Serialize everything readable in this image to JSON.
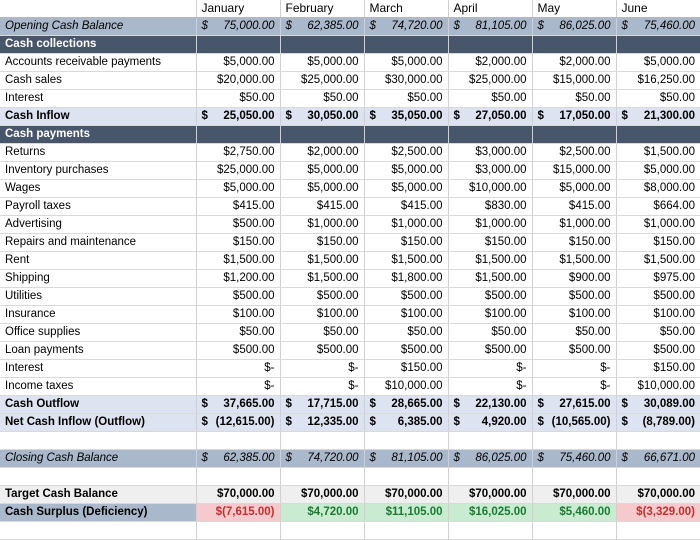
{
  "table": {
    "corner_label": "",
    "columns": [
      "January",
      "February",
      "March",
      "April",
      "May",
      "June"
    ],
    "rows": [
      {
        "kind": "balance",
        "label": "Opening Cash Balance",
        "values": [
          "$  75,000.00",
          "$ 62,385.00",
          "$ 74,720.00",
          "$ 81,105.00",
          "$ 86,025.00",
          "$ 75,460.00"
        ],
        "accounting": [
          "75,000.00",
          "62,385.00",
          "74,720.00",
          "81,105.00",
          "86,025.00",
          "75,460.00"
        ]
      },
      {
        "kind": "section",
        "label": "Cash collections",
        "values": [
          "",
          "",
          "",
          "",
          "",
          ""
        ]
      },
      {
        "kind": "data",
        "label": "Accounts receivable payments",
        "values": [
          "$5,000.00",
          "$5,000.00",
          "$5,000.00",
          "$2,000.00",
          "$2,000.00",
          "$5,000.00"
        ]
      },
      {
        "kind": "data",
        "label": "Cash sales",
        "values": [
          "$20,000.00",
          "$25,000.00",
          "$30,000.00",
          "$25,000.00",
          "$15,000.00",
          "$16,250.00"
        ]
      },
      {
        "kind": "data",
        "label": "Interest",
        "values": [
          "$50.00",
          "$50.00",
          "$50.00",
          "$50.00",
          "$50.00",
          "$50.00"
        ]
      },
      {
        "kind": "subtotal",
        "label": "Cash Inflow",
        "accounting": [
          "25,050.00",
          "30,050.00",
          "35,050.00",
          "27,050.00",
          "17,050.00",
          "21,300.00"
        ]
      },
      {
        "kind": "section",
        "label": "Cash payments",
        "values": [
          "",
          "",
          "",
          "",
          "",
          ""
        ]
      },
      {
        "kind": "data",
        "label": "Returns",
        "values": [
          "$2,750.00",
          "$2,000.00",
          "$2,500.00",
          "$3,000.00",
          "$2,500.00",
          "$1,500.00"
        ]
      },
      {
        "kind": "data",
        "label": "Inventory purchases",
        "values": [
          "$25,000.00",
          "$5,000.00",
          "$5,000.00",
          "$3,000.00",
          "$15,000.00",
          "$5,000.00"
        ]
      },
      {
        "kind": "data",
        "label": "Wages",
        "values": [
          "$5,000.00",
          "$5,000.00",
          "$5,000.00",
          "$10,000.00",
          "$5,000.00",
          "$8,000.00"
        ]
      },
      {
        "kind": "data",
        "label": "Payroll taxes",
        "values": [
          "$415.00",
          "$415.00",
          "$415.00",
          "$830.00",
          "$415.00",
          "$664.00"
        ]
      },
      {
        "kind": "data",
        "label": "Advertising",
        "values": [
          "$500.00",
          "$1,000.00",
          "$1,000.00",
          "$1,000.00",
          "$1,000.00",
          "$1,000.00"
        ]
      },
      {
        "kind": "data",
        "label": "Repairs and maintenance",
        "values": [
          "$150.00",
          "$150.00",
          "$150.00",
          "$150.00",
          "$150.00",
          "$150.00"
        ]
      },
      {
        "kind": "data",
        "label": "Rent",
        "values": [
          "$1,500.00",
          "$1,500.00",
          "$1,500.00",
          "$1,500.00",
          "$1,500.00",
          "$1,500.00"
        ]
      },
      {
        "kind": "data",
        "label": "Shipping",
        "values": [
          "$1,200.00",
          "$1,500.00",
          "$1,800.00",
          "$1,500.00",
          "$900.00",
          "$975.00"
        ]
      },
      {
        "kind": "data",
        "label": "Utilities",
        "values": [
          "$500.00",
          "$500.00",
          "$500.00",
          "$500.00",
          "$500.00",
          "$500.00"
        ]
      },
      {
        "kind": "data",
        "label": "Insurance",
        "values": [
          "$100.00",
          "$100.00",
          "$100.00",
          "$100.00",
          "$100.00",
          "$100.00"
        ]
      },
      {
        "kind": "data",
        "label": "Office supplies",
        "values": [
          "$50.00",
          "$50.00",
          "$50.00",
          "$50.00",
          "$50.00",
          "$50.00"
        ]
      },
      {
        "kind": "data",
        "label": "Loan payments",
        "values": [
          "$500.00",
          "$500.00",
          "$500.00",
          "$500.00",
          "$500.00",
          "$500.00"
        ]
      },
      {
        "kind": "data",
        "label": "Interest",
        "values": [
          "$-",
          "$-",
          "$150.00",
          "$-",
          "$-",
          "$150.00"
        ]
      },
      {
        "kind": "data",
        "label": "Income taxes",
        "values": [
          "$-",
          "$-",
          "$10,000.00",
          "$-",
          "$-",
          "$10,000.00"
        ]
      },
      {
        "kind": "subtotal",
        "label": "Cash Outflow",
        "accounting": [
          "37,665.00",
          "17,715.00",
          "28,665.00",
          "22,130.00",
          "27,615.00",
          "30,089.00"
        ]
      },
      {
        "kind": "subtotal",
        "label": "Net Cash Inflow (Outflow)",
        "accounting": [
          "(12,615.00)",
          "12,335.00",
          "6,385.00",
          "4,920.00",
          "(10,565.00)",
          "(8,789.00)"
        ]
      },
      {
        "kind": "balance",
        "label": "Closing Cash Balance",
        "accounting": [
          "62,385.00",
          "74,720.00",
          "81,105.00",
          "86,025.00",
          "75,460.00",
          "66,671.00"
        ]
      },
      {
        "kind": "target",
        "label": "Target Cash Balance",
        "values": [
          "$70,000.00",
          "$70,000.00",
          "$70,000.00",
          "$70,000.00",
          "$70,000.00",
          "$70,000.00"
        ]
      },
      {
        "kind": "surplus",
        "label": "Cash Surplus (Deficiency)",
        "values": [
          "$(7,615.00)",
          "$4,720.00",
          "$11,105.00",
          "$16,025.00",
          "$5,460.00",
          "$(3,329.00)"
        ],
        "signs": [
          "neg",
          "pos",
          "pos",
          "pos",
          "pos",
          "neg"
        ]
      }
    ]
  },
  "colors": {
    "section_band": "#47566b",
    "balance_band": "#a9b8cb",
    "subtotal_band": "#dde3f1",
    "target_band": "#efefef",
    "positive_fill": "#c9ecd0",
    "positive_text": "#1a7a34",
    "negative_fill": "#f6c9cc",
    "negative_text": "#c2302f"
  },
  "currency_symbol": "$"
}
